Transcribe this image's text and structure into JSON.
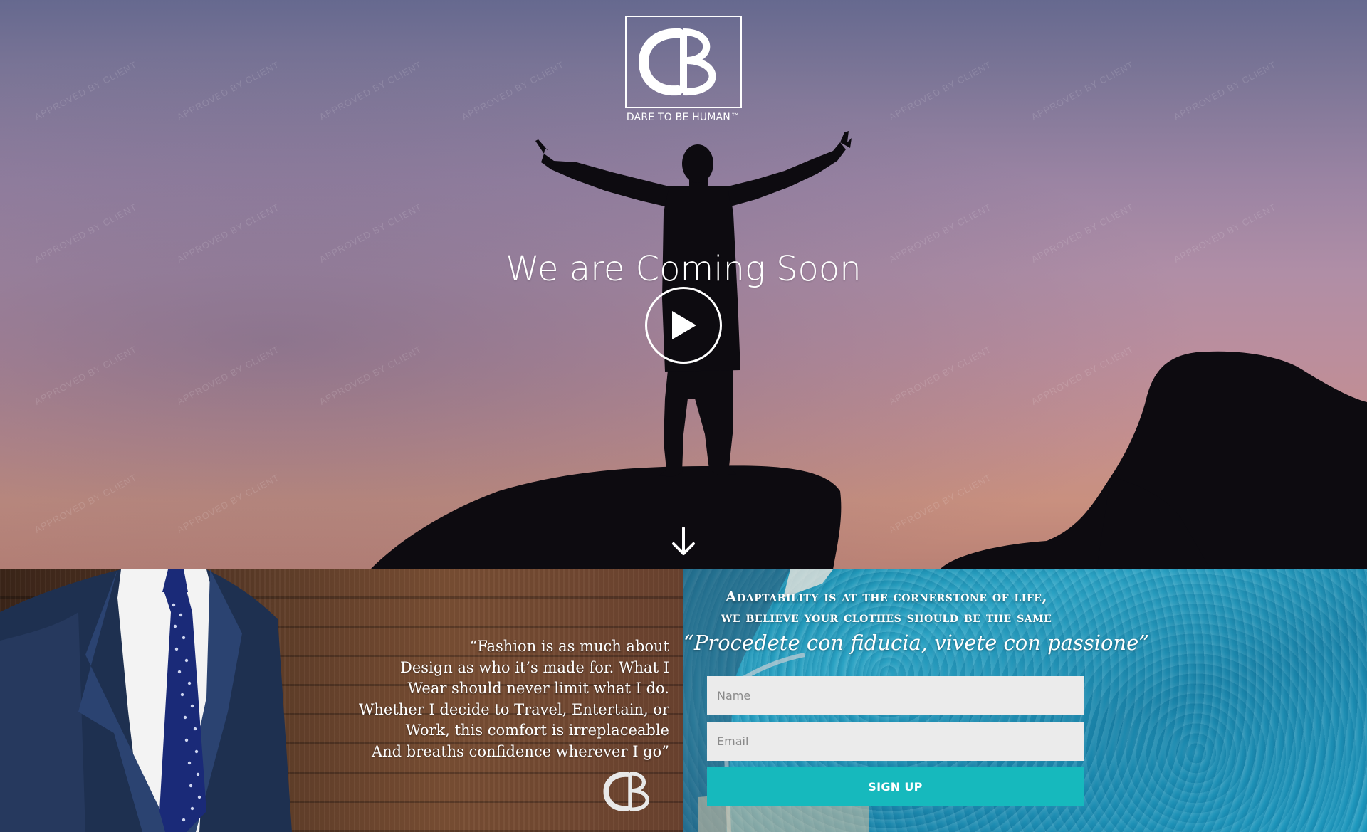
{
  "brand": {
    "tagline": "DARE TO BE HUMAN™"
  },
  "hero": {
    "headline": "We are Coming Soon"
  },
  "watermark": {
    "text": "APPROVED BY CLIENT"
  },
  "quote": {
    "lines": [
      "“Fashion is as much about",
      "Design as who it’s made for. What I",
      "Wear should never limit what I do.",
      "Whether I decide to Travel, Entertain, or",
      "Work, this comfort is irreplaceable",
      "And breaths confidence wherever I go”"
    ]
  },
  "signup": {
    "tagline_lines": [
      "Adaptability is at the cornerstone of life,",
      "we believe your clothes should be the same"
    ],
    "motto": "“Procedete con fiducia, vivete con passione”",
    "name_placeholder": "Name",
    "email_placeholder": "Email",
    "button_label": "SIGN UP"
  },
  "colors": {
    "accent": "#16b9bd",
    "input_bg": "#ebebeb",
    "text_light": "#ffffff"
  },
  "icons": {
    "play": "play-icon",
    "scroll": "arrow-down-icon",
    "logo": "cb-monogram-icon"
  }
}
